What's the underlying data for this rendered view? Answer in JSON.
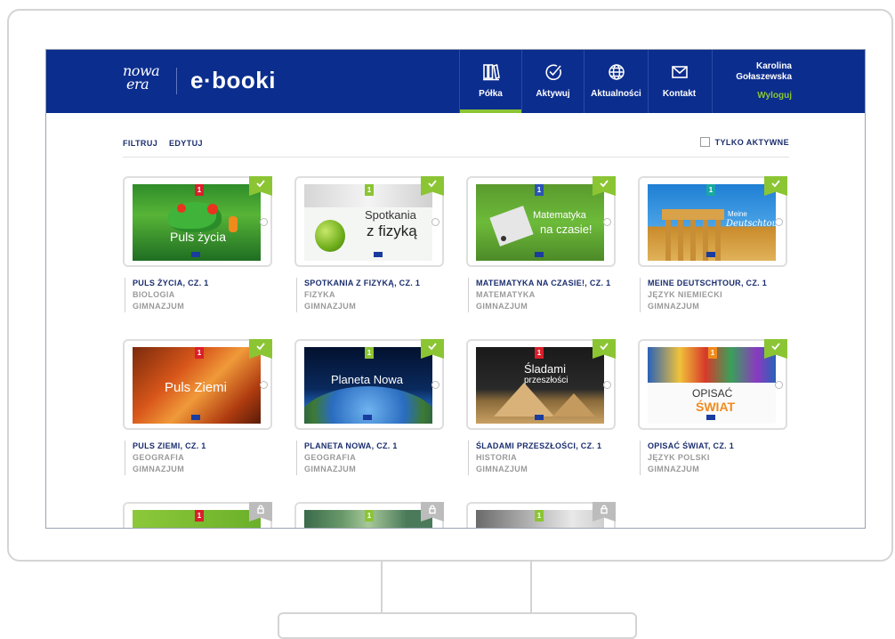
{
  "header": {
    "logo_top": "nowa",
    "logo_bottom": "era",
    "brand": "e·booki",
    "nav": [
      {
        "label": "Półka",
        "icon": "shelf-icon",
        "active": true
      },
      {
        "label": "Aktywuj",
        "icon": "check-circle-icon",
        "active": false
      },
      {
        "label": "Aktualności",
        "icon": "globe-icon",
        "active": false
      },
      {
        "label": "Kontakt",
        "icon": "envelope-icon",
        "active": false
      }
    ],
    "user": {
      "first": "Karolina",
      "last": "Gołaszewska",
      "logout": "Wyloguj"
    }
  },
  "toolbar": {
    "filter": "FILTRUJ",
    "edit": "EDYTUJ",
    "active_only": "TYLKO AKTYWNE"
  },
  "books": [
    {
      "title": "PULS ŻYCIA, CZ. 1",
      "subject": "BIOLOGIA",
      "level": "GIMNAZJUM",
      "cover_text": "Puls życia",
      "badge": "1",
      "status": "active"
    },
    {
      "title": "SPOTKANIA Z FIZYKĄ, CZ. 1",
      "subject": "FIZYKA",
      "level": "GIMNAZJUM",
      "cover_text_1": "Spotkania",
      "cover_text_2": "z fizyką",
      "badge": "1",
      "status": "active"
    },
    {
      "title": "MATEMATYKA NA CZASIE!, CZ. 1",
      "subject": "MATEMATYKA",
      "level": "GIMNAZJUM",
      "cover_text_1": "Matematyka",
      "cover_text_2": "na czasie!",
      "badge": "1",
      "status": "active"
    },
    {
      "title": "MEINE DEUTSCHTOUR, CZ. 1",
      "subject": "JĘZYK NIEMIECKI",
      "level": "GIMNAZJUM",
      "cover_text_1": "Meine",
      "cover_text_2": "Deutschtour",
      "badge": "1",
      "status": "active"
    },
    {
      "title": "PULS ZIEMI, CZ. 1",
      "subject": "GEOGRAFIA",
      "level": "GIMNAZJUM",
      "cover_text": "Puls Ziemi",
      "badge": "1",
      "status": "active"
    },
    {
      "title": "PLANETA NOWA, CZ. 1",
      "subject": "GEOGRAFIA",
      "level": "GIMNAZJUM",
      "cover_text": "Planeta Nowa",
      "badge": "1",
      "status": "active"
    },
    {
      "title": "ŚLADAMI PRZESZŁOŚCI, CZ. 1",
      "subject": "HISTORIA",
      "level": "GIMNAZJUM",
      "cover_text_1": "Śladami",
      "cover_text_2": "przeszłości",
      "badge": "1",
      "status": "active"
    },
    {
      "title": "OPISAĆ ŚWIAT, CZ. 1",
      "subject": "JĘZYK POLSKI",
      "level": "GIMNAZJUM",
      "cover_text_1": "OPISAĆ",
      "cover_text_2": "ŚWIAT",
      "badge": "1",
      "status": "active"
    },
    {
      "badge": "1",
      "status": "locked"
    },
    {
      "badge": "1",
      "status": "locked"
    },
    {
      "badge": "1",
      "status": "locked"
    }
  ],
  "colors": {
    "header": "#0b2d8e",
    "accent": "#8bc534",
    "title": "#1a2d6e",
    "muted": "#9a9a9a"
  }
}
